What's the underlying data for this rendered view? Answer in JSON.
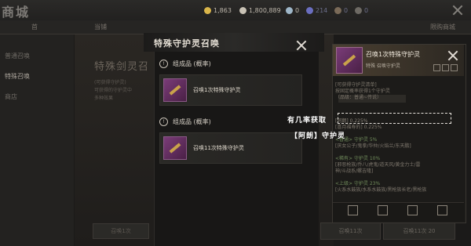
{
  "app": {
    "title": "商城"
  },
  "currencies": [
    {
      "name": "gold-coin-icon",
      "value": "1,863",
      "color": "#d9b54a"
    },
    {
      "name": "silver-coin-icon",
      "value": "1,800,889",
      "color": "#c9c2b5"
    },
    {
      "name": "jade-icon",
      "value": "0",
      "color": "#9fb7c9"
    },
    {
      "name": "gem-icon",
      "value": "214",
      "color": "#6a6ec0"
    },
    {
      "name": "token-icon",
      "value": "0",
      "color": "#7a6a58"
    },
    {
      "name": "ticket-icon",
      "value": "0",
      "color": "#6e6a64"
    }
  ],
  "tabs": [
    "首",
    "当铺",
    "限购商城"
  ],
  "sidebar": {
    "items": [
      {
        "label": "普通召唤"
      },
      {
        "label": "特殊召唤"
      },
      {
        "label": "商店"
      }
    ]
  },
  "background": {
    "title": "特殊剑灵召",
    "lines": [
      "(可获得守护灵)",
      "可获得的守护灵中",
      "多种效果"
    ],
    "buttons": [
      "召唤1次",
      "召唤11次",
      "召唤11次 20"
    ]
  },
  "modal": {
    "title": "特殊守护灵召唤",
    "sections": [
      {
        "header": "组成品 (概率)",
        "option": "召唤1次特殊守护灵"
      },
      {
        "header": "组成品 (概率)",
        "option": "召唤11次特殊守护灵"
      }
    ]
  },
  "item_panel": {
    "title": "召唤1次特殊守护灵",
    "subtitle": "特殊 召唤守护灵",
    "lines": [
      "[可获得守护灵清单]",
      "按固定概率获得1个守护灵",
      "（品级：普通~传说）",
      "[阿朗] 0.225%",
      "[喜月福寿的] 0.225%",
      "<普通> 守护灵 5%",
      "[厌女公子/鬼拳/华仲/火焰兰/东天鹏]",
      "<稀有> 守护灵 10%",
      "[邪恶枪族/乔八/虎鬼/道天风/黄金力士/雷",
      "神/斗战系/螺吉隆]",
      "<上级> 守护灵 23%",
      "[火系水鼓族/水系水鼓族/黑枪族长老/黑枪族"
    ]
  },
  "annotation": {
    "line1": "有几率获取",
    "line2": "【阿朗】守护灵"
  }
}
